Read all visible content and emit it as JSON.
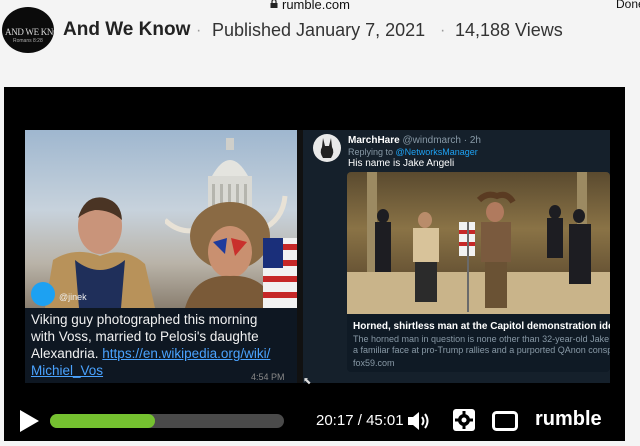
{
  "browser": {
    "url": "rumble.com",
    "done_label": "Done"
  },
  "channel": {
    "logo_line1": "AND WE KNOW",
    "logo_line2": "Romans 8:28",
    "name": "And We Know",
    "separator": "·",
    "published": "Published January 7, 2021",
    "views": "14,188 Views"
  },
  "video": {
    "left_tweet": {
      "handle": "@jinek",
      "caption_line1": "Viking guy photographed this morning",
      "caption_line2": "with Voss, married to Pelosi's daughte",
      "caption_line3_text": "Alexandria. ",
      "caption_link_part1": "https://en.wikipedia.org/wiki/",
      "caption_link_part2": "Michiel_Vos",
      "time": "4:54 PM"
    },
    "right_tweet": {
      "user": "MarchHare",
      "handle": "@windmarch · 2h",
      "replying_prefix": "Replying to",
      "replying_to": "@NetworksManager",
      "text": "His name is Jake Angeli",
      "card_title": "Horned, shirtless man at the Capitol demonstration identified",
      "card_desc_line1": "The horned man in question is none other than 32-year-old Jake Angeli,",
      "card_desc_line2": "a familiar face at pro-Trump rallies and a purported QAnon conspiracy...",
      "card_source": "fox59.com"
    }
  },
  "controls": {
    "progress": 0.4467,
    "time_current": "20:17",
    "time_separator": " / ",
    "time_total": "45:01",
    "brand": "rumble",
    "accent_color": "#75c130",
    "icons": [
      "play-icon",
      "volume-icon",
      "settings-gear-icon",
      "theater-mode-icon"
    ]
  }
}
